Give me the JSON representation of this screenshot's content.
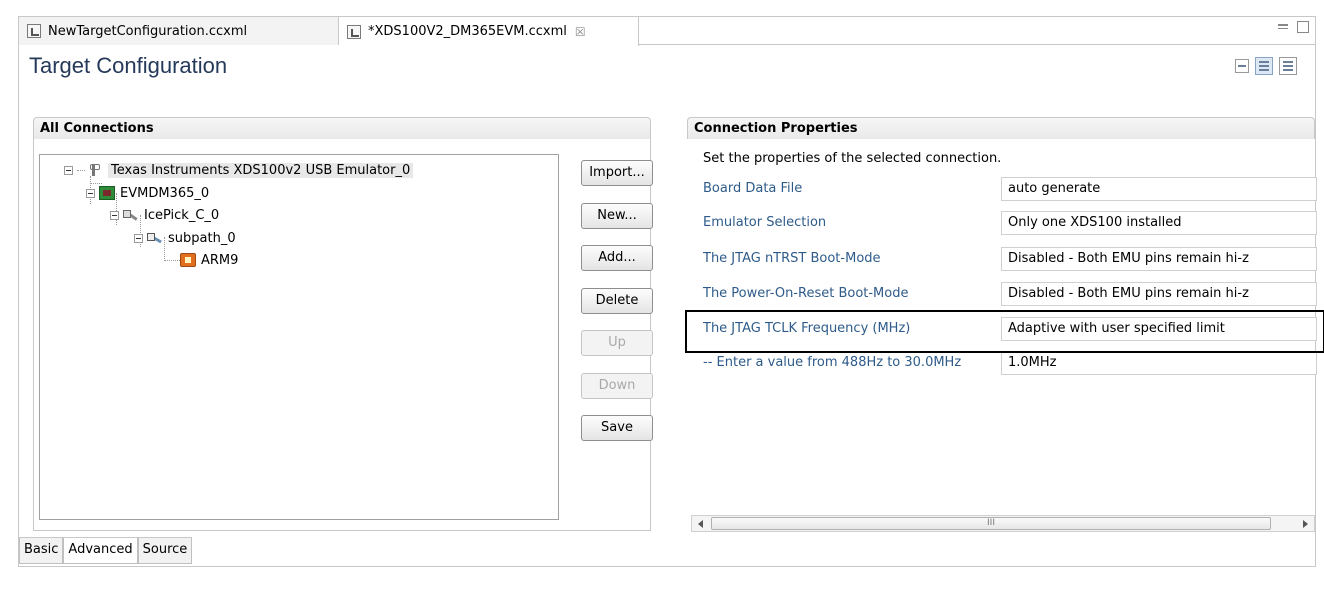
{
  "editor_tabs": [
    {
      "label": "NewTargetConfiguration.ccxml",
      "active": false
    },
    {
      "label": "*XDS100V2_DM365EVM.ccxml",
      "active": true,
      "close_glyph": "☒"
    }
  ],
  "page_title": "Target Configuration",
  "connections": {
    "header": "All Connections",
    "tree": [
      {
        "label": "Texas Instruments XDS100v2 USB Emulator_0",
        "icon": "emulator-icon",
        "selected": true
      },
      {
        "label": "EVMDM365_0",
        "icon": "board-icon"
      },
      {
        "label": "IcePick_C_0",
        "icon": "icepick-icon"
      },
      {
        "label": "subpath_0",
        "icon": "subpath-icon"
      },
      {
        "label": "ARM9",
        "icon": "cpu-icon"
      }
    ],
    "buttons": {
      "import": "Import...",
      "new": "New...",
      "add": "Add...",
      "delete": "Delete",
      "up": "Up",
      "down": "Down",
      "save": "Save"
    }
  },
  "properties": {
    "header": "Connection Properties",
    "description": "Set the properties of the selected connection.",
    "rows": [
      {
        "label": "Board Data File",
        "value": "auto generate"
      },
      {
        "label": "Emulator Selection",
        "value": "Only one XDS100 installed"
      },
      {
        "label": "The JTAG nTRST Boot-Mode",
        "value": "Disabled - Both EMU pins remain hi-z"
      },
      {
        "label": "The Power-On-Reset Boot-Mode",
        "value": "Disabled - Both EMU pins remain hi-z"
      },
      {
        "label": "The JTAG TCLK Frequency (MHz)",
        "value": "Adaptive with user specified limit"
      },
      {
        "label": "-- Enter a value from 488Hz to 30.0MHz",
        "value": "1.0MHz"
      }
    ],
    "scroll_grip": "III"
  },
  "bottom_tabs": [
    {
      "label": "Basic",
      "active": false
    },
    {
      "label": "Advanced",
      "active": true
    },
    {
      "label": "Source",
      "active": false
    }
  ]
}
